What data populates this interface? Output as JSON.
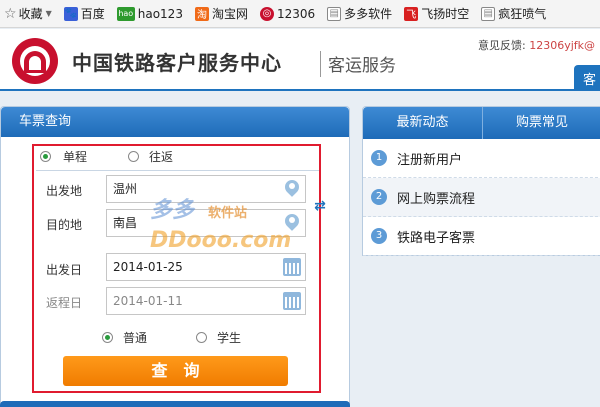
{
  "bookmarks": {
    "favorites_label": "收藏",
    "items": [
      {
        "label": "百度",
        "icon": "baidu-paw-icon",
        "color": "#3a60d8"
      },
      {
        "label": "hao123",
        "icon": "hao123-icon",
        "color": "#2e9a2e"
      },
      {
        "label": "淘宝网",
        "icon": "taobao-icon",
        "color": "#f06a18"
      },
      {
        "label": "12306",
        "icon": "12306-icon",
        "color": "#c8102e"
      },
      {
        "label": "多多软件",
        "icon": "page-icon",
        "color": "#888888"
      },
      {
        "label": "飞扬时空",
        "icon": "feiyang-icon",
        "color": "#d82020"
      },
      {
        "label": "疯狂喷气",
        "icon": "page-icon",
        "color": "#888888"
      }
    ]
  },
  "header": {
    "title": "中国铁路客户服务中心",
    "subtitle": "客运服务",
    "feedback_label": "意见反馈:",
    "feedback_email": "12306yjfk@",
    "tab_label": "客"
  },
  "ticket_query": {
    "panel_title": "车票查询",
    "trip_one_way": "单程",
    "trip_round": "往返",
    "from_label": "出发地",
    "from_value": "温州",
    "to_label": "目的地",
    "to_value": "南昌",
    "depart_label": "出发日",
    "depart_value": "2014-01-25",
    "return_label": "返程日",
    "return_value": "2014-01-11",
    "type_normal": "普通",
    "type_student": "学生",
    "search_button": "查询"
  },
  "watermark": {
    "line1": "多多",
    "line2": "软件站",
    "line3": "DDooo.com"
  },
  "right_panel": {
    "tabs": [
      "最新动态",
      "购票常见"
    ],
    "items": [
      {
        "num": "1",
        "label": "注册新用户"
      },
      {
        "num": "2",
        "label": "网上购票流程"
      },
      {
        "num": "3",
        "label": "铁路电子客票"
      }
    ]
  },
  "colors": {
    "accent": "#1e73be",
    "highlight_box": "#e01b2f",
    "search_button": "#f07c00"
  }
}
